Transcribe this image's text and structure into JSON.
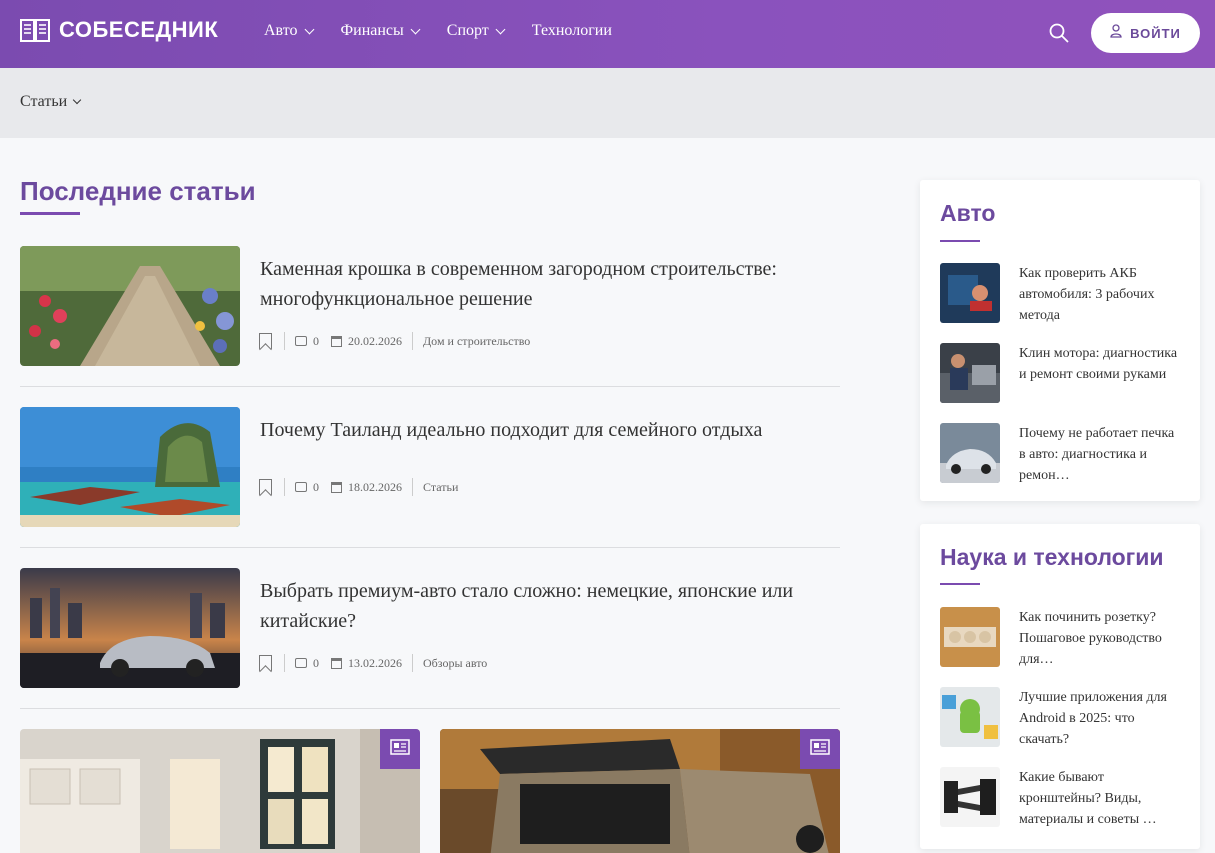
{
  "header": {
    "logo_text": "СОБЕСЕДНИК",
    "nav": [
      {
        "label": "Авто",
        "has_dropdown": true
      },
      {
        "label": "Финансы",
        "has_dropdown": true
      },
      {
        "label": "Спорт",
        "has_dropdown": true
      },
      {
        "label": "Технологии",
        "has_dropdown": false
      }
    ],
    "login_label": "ВОЙТИ"
  },
  "subbar": {
    "label": "Статьи"
  },
  "main": {
    "section_title": "Последние статьи",
    "articles": [
      {
        "title": "Каменная крошка в современном загородном строительстве: многофункциональное решение",
        "comments": "0",
        "date": "20.02.2026",
        "category": "Дом и строительство"
      },
      {
        "title": "Почему Таиланд идеально подходит для семейного отдыха",
        "comments": "0",
        "date": "18.02.2026",
        "category": "Статьи"
      },
      {
        "title": "Выбрать премиум-авто стало сложно: немецкие, японские или китайские?",
        "comments": "0",
        "date": "13.02.2026",
        "category": "Обзоры авто"
      }
    ]
  },
  "sidebar": {
    "widgets": [
      {
        "title": "Авто",
        "items": [
          {
            "text": "Как проверить АКБ автомобиля: 3 рабочих метода"
          },
          {
            "text": "Клин мотора: диагностика и ремонт своими руками"
          },
          {
            "text": "Почему не работает печка в авто: диагностика и ремон…"
          }
        ]
      },
      {
        "title": "Наука и технологии",
        "items": [
          {
            "text": "Как починить розетку? Пошаговое руководство для…"
          },
          {
            "text": "Лучшие приложения для Android в 2025: что скачать?"
          },
          {
            "text": "Какие бывают кронштейны? Виды, материалы и советы …"
          }
        ]
      }
    ]
  },
  "colors": {
    "brand": "#7b4bb0",
    "title": "#6c4a9e"
  }
}
